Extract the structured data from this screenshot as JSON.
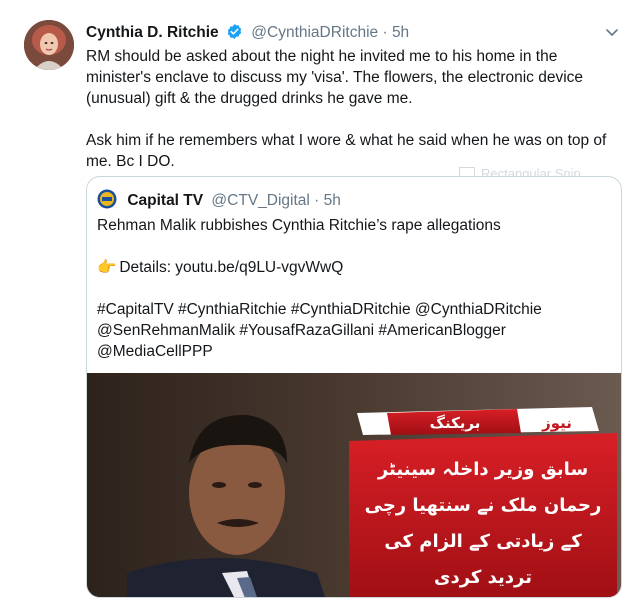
{
  "tweet": {
    "author_name": "Cynthia D. Ritchie",
    "handle": "@CynthiaDRitchie",
    "separator": "·",
    "time": "5h",
    "paragraphs": [
      "RM should be asked about the night he invited me to his home in the minister's enclave to discuss my 'visa'. The flowers, the electronic device (unusual) gift & the drugged drinks he gave me.",
      "Ask him if he remembers what I wore & what he said when he was on top of me. Bc I DO."
    ]
  },
  "watermark": {
    "label": "Rectangular Snip"
  },
  "quoted": {
    "author_name": "Capital TV",
    "handle": "@CTV_Digital",
    "separator": "·",
    "time": "5h",
    "headline": "Rehman Malik rubbishes Cynthia Ritchie’s rape allegations",
    "details_emoji": "👉",
    "details_text": "Details: youtu.be/q9LU-vgvWwQ",
    "hashtags": "#CapitalTV #CynthiaRitchie #CynthiaDRitchie @CynthiaDRitchie @SenRehmanMalik #YousafRazaGillani #AmericanBlogger @MediaCellPPP",
    "image": {
      "banner_left": "بریکنگ",
      "banner_right": "نیوز",
      "urdu_lines": [
        "سابق وزیر داخلہ سینیٹر",
        "رحمان ملک نے سنتھیا رچی",
        "کے زیادتی کے الزام کی",
        "تردید کردی"
      ]
    }
  },
  "colors": {
    "verified": "#1da1f2",
    "secondary_text": "#657786",
    "border": "#ccd6dd",
    "banner_red": "#c4161c",
    "banner_white": "#ffffff"
  }
}
